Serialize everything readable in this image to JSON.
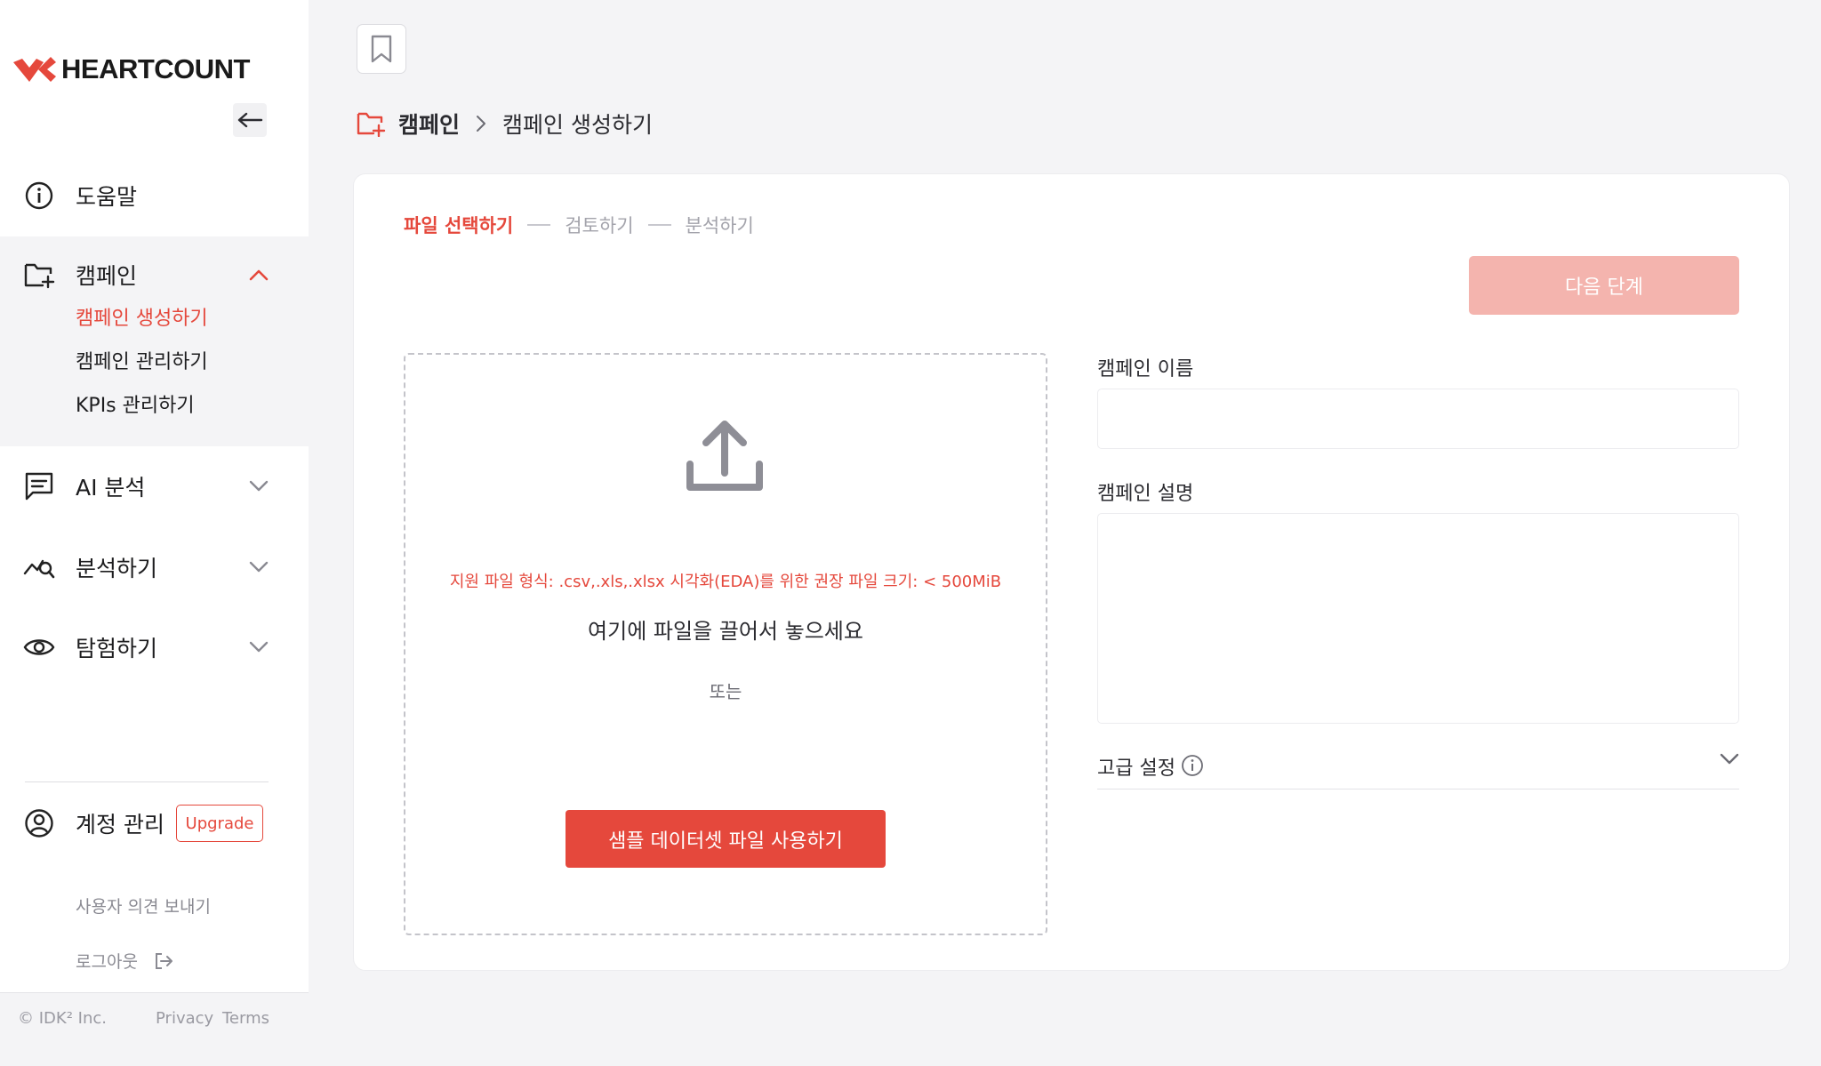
{
  "brand": {
    "name": "HEARTCOUNT",
    "accent": "#e5483c",
    "accent_light": "#f4b4ae"
  },
  "sidebar": {
    "help_label": "도움말",
    "campaign": {
      "label": "캠페인",
      "items": [
        {
          "label": "캠페인 생성하기",
          "active": true
        },
        {
          "label": "캠페인 관리하기",
          "active": false
        },
        {
          "label": "KPIs 관리하기",
          "active": false
        }
      ]
    },
    "ai_label": "AI 분석",
    "analyze_label": "분석하기",
    "explore_label": "탐험하기",
    "account_label": "계정 관리",
    "upgrade_label": "Upgrade",
    "feedback_label": "사용자 의견 보내기",
    "logout_label": "로그아웃",
    "copyright": "© IDK² Inc.",
    "privacy_label": "Privacy",
    "terms_label": "Terms"
  },
  "breadcrumb": {
    "root": "캠페인",
    "current": "캠페인 생성하기"
  },
  "steps": [
    {
      "label": "파일 선택하기",
      "active": true
    },
    {
      "label": "검토하기",
      "active": false
    },
    {
      "label": "분석하기",
      "active": false
    }
  ],
  "next_label": "다음 단계",
  "dropzone": {
    "formats": "지원 파일 형식: .csv,.xls,.xlsx 시각화(EDA)를 위한 권장 파일 크기: < 500MiB",
    "title": "여기에 파일을 끌어서 놓으세요",
    "or": "또는",
    "sample_label": "샘플 데이터셋 파일 사용하기"
  },
  "form": {
    "name_label": "캠페인 이름",
    "name_value": "",
    "desc_label": "캠페인 설명",
    "desc_value": "",
    "advanced_label": "고급 설정"
  }
}
